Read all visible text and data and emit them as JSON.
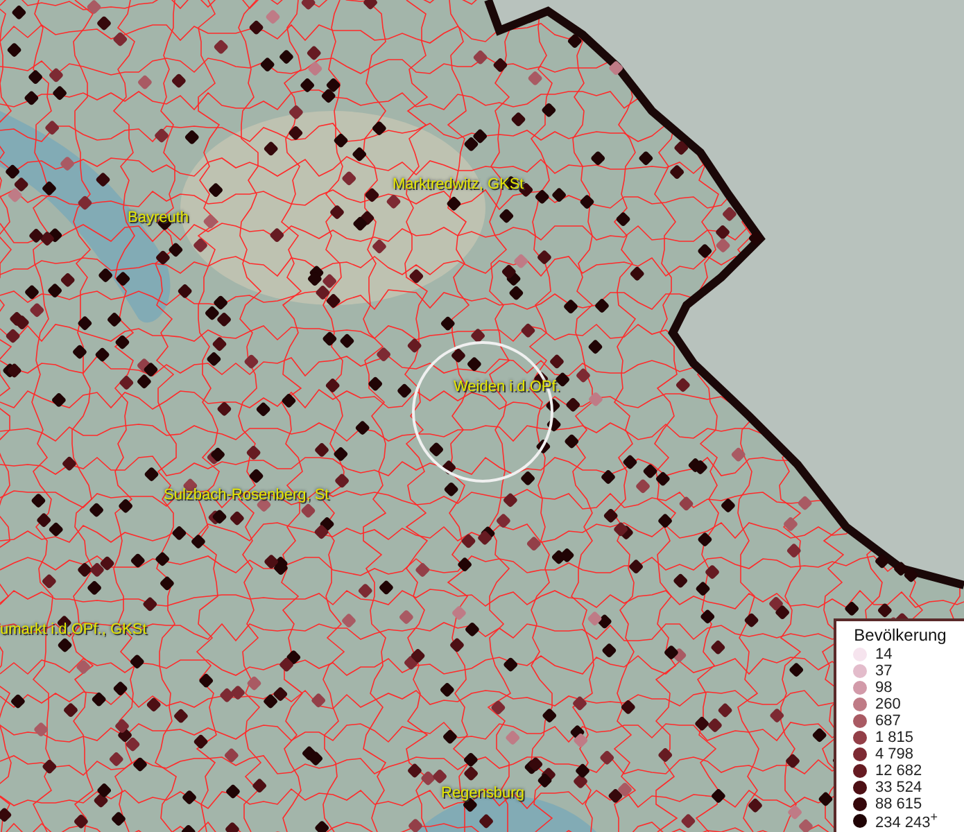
{
  "map": {
    "places": [
      {
        "name": "Marktredwitz, GKSt"
      },
      {
        "name": "Bayreuth"
      },
      {
        "name": "Weiden i.d.OPf."
      },
      {
        "name": "Sulzbach-Rosenberg, St"
      },
      {
        "name": "umarkt i.d.OPf., GKSt"
      },
      {
        "name": "Regensburg"
      }
    ]
  },
  "legend": {
    "title": "Bevölkerung",
    "items": [
      {
        "label": "14",
        "color": "#f6e4ee"
      },
      {
        "label": "37",
        "color": "#e3bccb"
      },
      {
        "label": "98",
        "color": "#d29aa9"
      },
      {
        "label": "260",
        "color": "#bf7b86"
      },
      {
        "label": "687",
        "color": "#a95a63"
      },
      {
        "label": "1 815",
        "color": "#933f48"
      },
      {
        "label": "4 798",
        "color": "#7d2a33"
      },
      {
        "label": "12 682",
        "color": "#661b22"
      },
      {
        "label": "33 524",
        "color": "#4d0f14"
      },
      {
        "label": "88 615",
        "color": "#36080b"
      },
      {
        "label": "234 243$^{+}$",
        "color": "#200405"
      }
    ]
  }
}
